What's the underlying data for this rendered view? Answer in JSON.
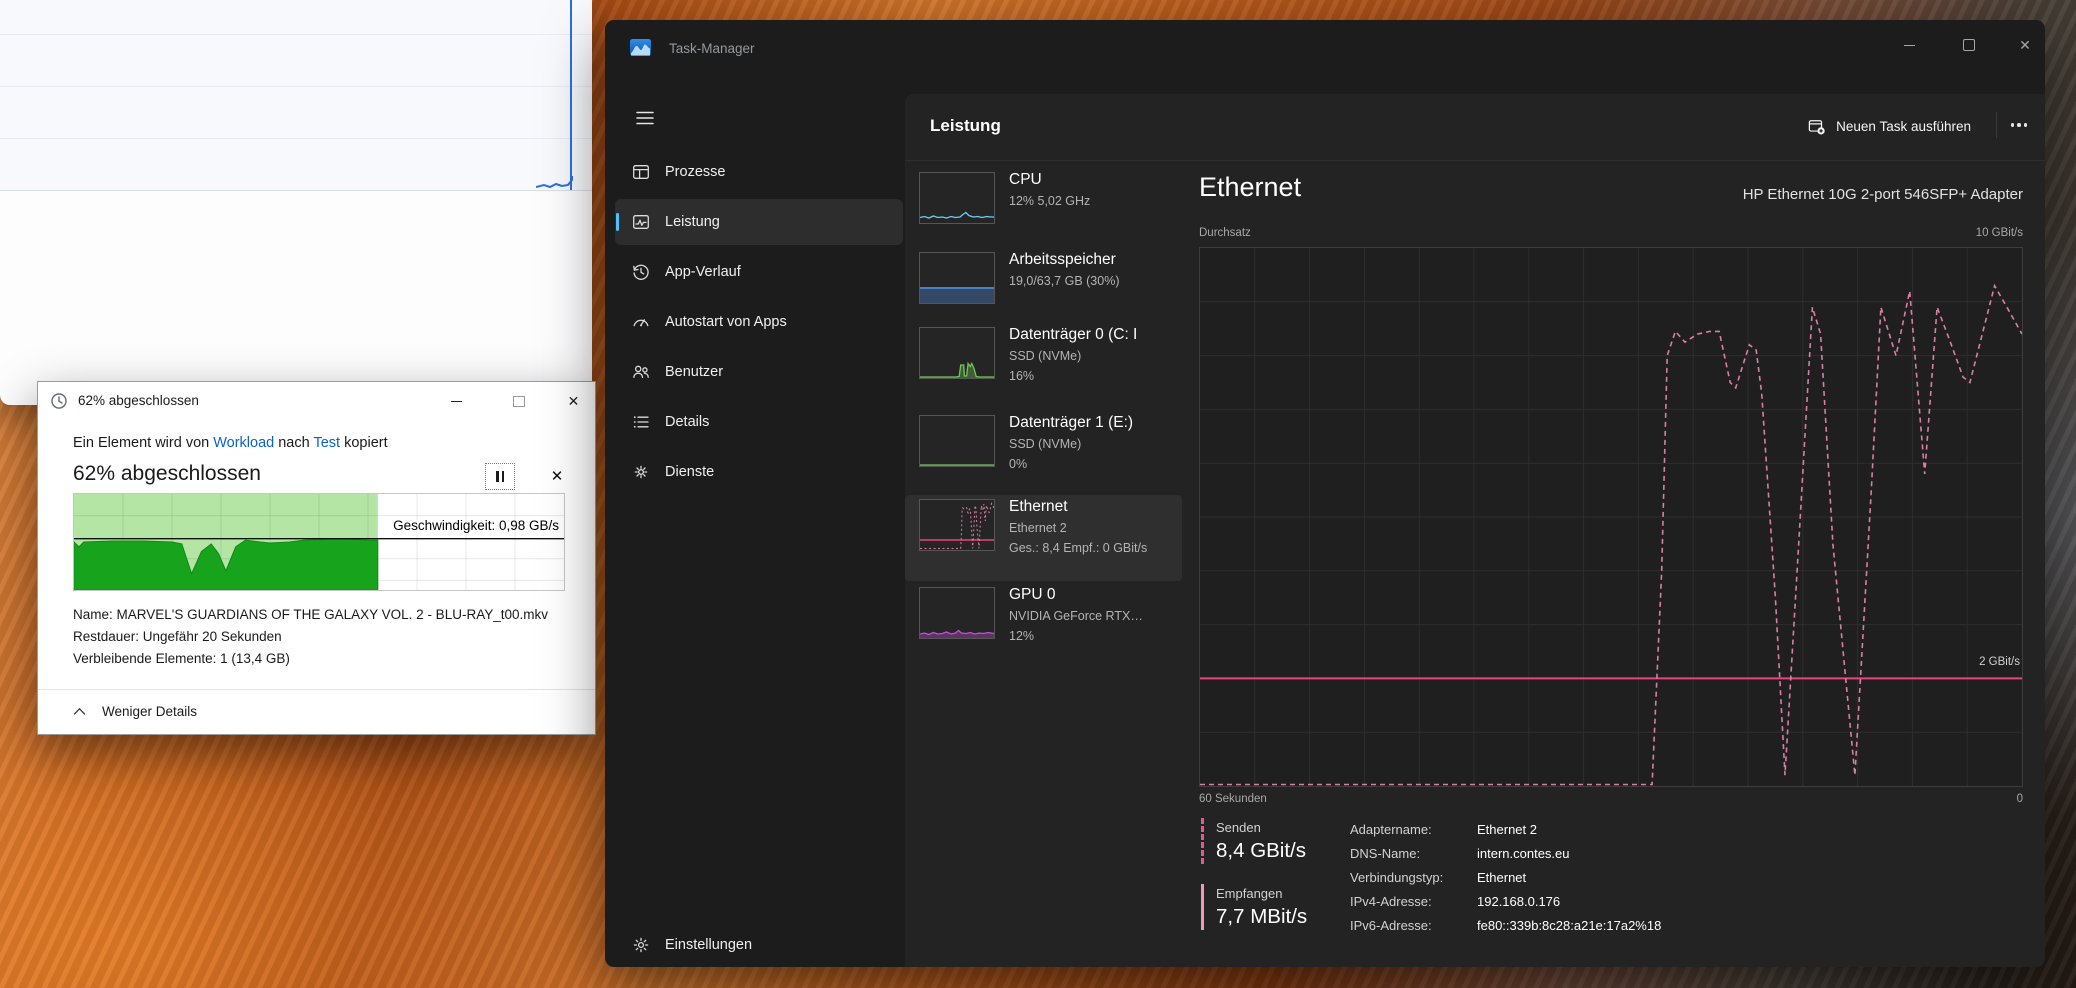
{
  "copy_dialog": {
    "titlebar": {
      "title": "62% abgeschlossen"
    },
    "message": {
      "prefix": "Ein Element wird von ",
      "source": "Workload",
      "conn": " nach ",
      "dest": "Test",
      "suffix": " kopiert"
    },
    "heading": "62% abgeschlossen",
    "speed_label": "Geschwindigkeit: 0,98 GB/s",
    "details": [
      "Name: MARVEL'S GUARDIANS OF THE GALAXY VOL. 2 - BLU-RAY_t00.mkv",
      "Restdauer: Ungefähr 20 Sekunden",
      "Verbleibende Elemente: 1 (13,4 GB)"
    ],
    "toggle": "Weniger Details",
    "progress_percent": 62
  },
  "task_manager": {
    "title": "Task-Manager",
    "page_title": "Leistung",
    "toolbar": {
      "new_task": "Neuen Task ausführen"
    },
    "sidebar": [
      {
        "label": "Prozesse"
      },
      {
        "label": "Leistung"
      },
      {
        "label": "App-Verlauf"
      },
      {
        "label": "Autostart von Apps"
      },
      {
        "label": "Benutzer"
      },
      {
        "label": "Details"
      },
      {
        "label": "Dienste"
      }
    ],
    "settings": "Einstellungen",
    "perf_items": [
      {
        "title": "CPU",
        "line1": "12% 5,02 GHz",
        "line2": "",
        "spark": {
          "kind": "line",
          "color": "#6ccef2",
          "points": [
            [
              0,
              11
            ],
            [
              6,
              13
            ],
            [
              12,
              10
            ],
            [
              18,
              14
            ],
            [
              24,
              11
            ],
            [
              30,
              12
            ],
            [
              36,
              10
            ],
            [
              42,
              13
            ],
            [
              48,
              11
            ],
            [
              54,
              12
            ],
            [
              58,
              17
            ],
            [
              62,
              21
            ],
            [
              66,
              15
            ],
            [
              72,
              12
            ],
            [
              78,
              13
            ],
            [
              84,
              11
            ],
            [
              90,
              13
            ],
            [
              96,
              12
            ],
            [
              100,
              12
            ]
          ]
        }
      },
      {
        "title": "Arbeitsspeicher",
        "line1": "19,0/63,7 GB (30%)",
        "line2": "",
        "spark": {
          "kind": "level",
          "color": "#4a7fc9",
          "level": 30
        }
      },
      {
        "title": "Datenträger 0 (C: I",
        "line1": "SSD (NVMe)",
        "line2": "16%",
        "spark": {
          "kind": "area",
          "color": "#71c857",
          "points": [
            [
              0,
              2
            ],
            [
              48,
              2
            ],
            [
              53,
              3
            ],
            [
              55,
              26
            ],
            [
              59,
              26
            ],
            [
              60,
              4
            ],
            [
              63,
              4
            ],
            [
              65,
              29
            ],
            [
              68,
              23
            ],
            [
              70,
              29
            ],
            [
              73,
              19
            ],
            [
              76,
              3
            ],
            [
              80,
              2
            ],
            [
              100,
              2
            ]
          ]
        }
      },
      {
        "title": "Datenträger 1 (E:)",
        "line1": "SSD (NVMe)",
        "line2": "0%",
        "spark": {
          "kind": "area",
          "color": "#71c857",
          "points": [
            [
              0,
              2
            ],
            [
              100,
              2
            ]
          ]
        }
      },
      {
        "title": "Ethernet",
        "line1": "Ethernet 2",
        "line2": "Ges.: 8,4 Empf.: 0 GBit/s",
        "spark": {
          "kind": "ethernet"
        }
      },
      {
        "title": "GPU 0",
        "line1": "NVIDIA GeForce RTX…",
        "line2": "12%",
        "spark": {
          "kind": "area",
          "color": "#c24fd8",
          "points": [
            [
              0,
              8
            ],
            [
              6,
              10
            ],
            [
              12,
              7
            ],
            [
              18,
              11
            ],
            [
              24,
              8
            ],
            [
              30,
              9
            ],
            [
              36,
              12
            ],
            [
              42,
              8
            ],
            [
              48,
              10
            ],
            [
              52,
              15
            ],
            [
              56,
              10
            ],
            [
              62,
              9
            ],
            [
              68,
              11
            ],
            [
              74,
              8
            ],
            [
              80,
              10
            ],
            [
              86,
              9
            ],
            [
              92,
              11
            ],
            [
              100,
              9
            ]
          ]
        }
      }
    ],
    "detail": {
      "title": "Ethernet",
      "adapter": "HP Ethernet 10G 2-port 546SFP+ Adapter",
      "axis_top_left": "Durchsatz",
      "axis_top_right": "10 GBit/s",
      "axis_bottom_left": "60 Sekunden",
      "axis_bottom_right": "0",
      "ref_label": "2 GBit/s",
      "stats": [
        {
          "label": "Senden",
          "value": "8,4 GBit/s"
        },
        {
          "label": "Empfangen",
          "value": "7,7 MBit/s"
        }
      ],
      "props": [
        {
          "label": "Adaptername:",
          "value": "Ethernet 2"
        },
        {
          "label": "DNS-Name:",
          "value": "intern.contes.eu"
        },
        {
          "label": "Verbindungstyp:",
          "value": "Ethernet"
        },
        {
          "label": "IPv4-Adresse:",
          "value": "192.168.0.176"
        },
        {
          "label": "IPv6-Adresse:",
          "value": "fe80::339b:8c28:a21e:17a2%18"
        }
      ]
    }
  },
  "chart_data": [
    {
      "id": "ethernet-throughput",
      "type": "line",
      "title": "Durchsatz",
      "xlabel": "Sekunden",
      "ylabel": "GBit/s",
      "ylim": [
        0,
        10
      ],
      "x_range_seconds": [
        60,
        0
      ],
      "grid": true,
      "reference_line": {
        "value": 2,
        "label": "2 GBit/s"
      },
      "series": [
        {
          "name": "Senden",
          "style": "dashed",
          "unit": "GBit/s",
          "current": "8,4 GBit/s",
          "points": [
            [
              60,
              0
            ],
            [
              27,
              0
            ],
            [
              26.3,
              4
            ],
            [
              25.9,
              8
            ],
            [
              25.3,
              8.45
            ],
            [
              24.6,
              8.25
            ],
            [
              23.7,
              8.4
            ],
            [
              22.8,
              8.45
            ],
            [
              22.1,
              8.45
            ],
            [
              21.3,
              7.5
            ],
            [
              20.9,
              7.4
            ],
            [
              20.4,
              7.8
            ],
            [
              19.9,
              8.2
            ],
            [
              19.4,
              8.1
            ],
            [
              19,
              7.3
            ],
            [
              18,
              3.5
            ],
            [
              17.3,
              0.2
            ],
            [
              16.3,
              4.5
            ],
            [
              15.3,
              8.9
            ],
            [
              14.7,
              8.4
            ],
            [
              13.8,
              4.5
            ],
            [
              12.2,
              0.2
            ],
            [
              11,
              5.5
            ],
            [
              10.3,
              8.9
            ],
            [
              9.2,
              8
            ],
            [
              8.2,
              9.2
            ],
            [
              7.1,
              5.8
            ],
            [
              6.2,
              8.9
            ],
            [
              5.3,
              8.3
            ],
            [
              4.3,
              7.6
            ],
            [
              3.8,
              7.5
            ],
            [
              3,
              8.3
            ],
            [
              2,
              9.3
            ],
            [
              1.1,
              8.9
            ],
            [
              0,
              8.4
            ]
          ]
        },
        {
          "name": "Empfangen",
          "style": "solid",
          "unit": "MBit/s",
          "current": "7,7 MBit/s",
          "points": []
        }
      ]
    },
    {
      "id": "copy-speed",
      "type": "area",
      "title": "Geschwindigkeit: 0,98 GB/s",
      "progress_percent": 62,
      "scale_line_pct_from_bottom": 53.5,
      "points_pct": [
        [
          0,
          50
        ],
        [
          1,
          45
        ],
        [
          2,
          50
        ],
        [
          8,
          51
        ],
        [
          14,
          51
        ],
        [
          20,
          50
        ],
        [
          22,
          48
        ],
        [
          24,
          17
        ],
        [
          26,
          40
        ],
        [
          28,
          48
        ],
        [
          29.5,
          38
        ],
        [
          31,
          20
        ],
        [
          33,
          45
        ],
        [
          35,
          52
        ],
        [
          38,
          50
        ],
        [
          40,
          49
        ],
        [
          44,
          50
        ],
        [
          47,
          52
        ],
        [
          52,
          53
        ],
        [
          56,
          53
        ],
        [
          60,
          52
        ],
        [
          62,
          52
        ]
      ]
    }
  ],
  "colors": {
    "accent": "#4cc2ff",
    "pink_solid": "#e9447e",
    "pink_dashed": "#d97fa4",
    "green_dark": "#18a31d",
    "green_light": "#b4e5a4",
    "grid_dark": "#2e2e2e"
  }
}
